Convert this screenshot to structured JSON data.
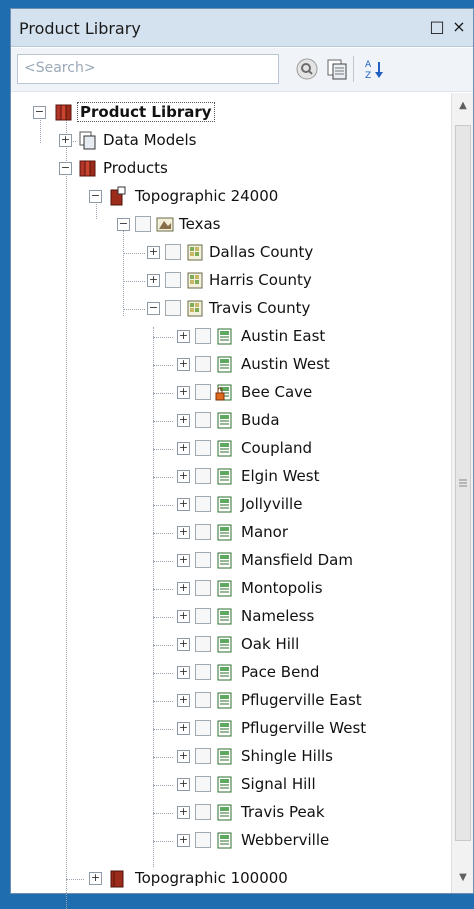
{
  "panel": {
    "title": "Product Library",
    "float_glyph": "□",
    "close_glyph": "×"
  },
  "toolbar": {
    "search_placeholder": "<Search>"
  },
  "tree": {
    "root": "Product Library",
    "data_models": "Data Models",
    "products": "Products",
    "topographic_24000": "Topographic 24000",
    "texas": "Texas",
    "counties": [
      "Dallas County",
      "Harris County",
      "Travis County"
    ],
    "travis_quads": [
      "Austin East",
      "Austin West",
      "Bee Cave",
      "Buda",
      "Coupland",
      "Elgin West",
      "Jollyville",
      "Manor",
      "Mansfield Dam",
      "Montopolis",
      "Nameless",
      "Oak Hill",
      "Pace Bend",
      "Pflugerville East",
      "Pflugerville West",
      "Shingle Hills",
      "Signal Hill",
      "Travis Peak",
      "Webberville"
    ],
    "topographic_100000": "Topographic 100000"
  },
  "colors": {
    "desktop": "#1f6cae",
    "titlebar": "#d4e1ef",
    "book": "#9b2b1a"
  },
  "scrollbar": {
    "up_glyph": "▲",
    "down_glyph": "▼"
  }
}
